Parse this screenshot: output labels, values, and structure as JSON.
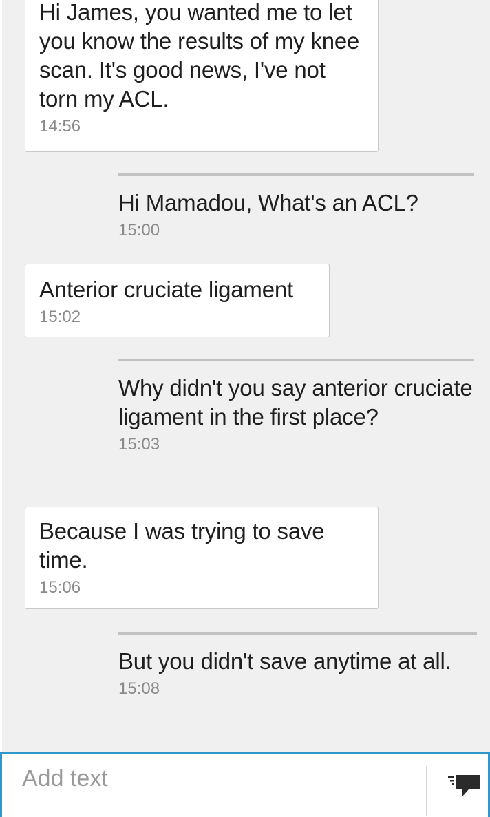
{
  "messages": [
    {
      "direction": "incoming",
      "text": "Hi James, you wanted me to let you know the results of my knee scan. It's good news, I've not torn my ACL.",
      "time": "14:56"
    },
    {
      "direction": "outgoing",
      "text": "Hi Mamadou, What's an ACL?",
      "time": "15:00"
    },
    {
      "direction": "incoming",
      "text": "Anterior cruciate ligament",
      "time": "15:02"
    },
    {
      "direction": "outgoing",
      "text": "Why didn't you say anterior cruciate ligament in the first place?",
      "time": "15:03"
    },
    {
      "direction": "incoming",
      "text": "Because I was trying to save time.",
      "time": "15:06"
    },
    {
      "direction": "outgoing",
      "text": "But you didn't save anytime at all.",
      "time": "15:08"
    }
  ],
  "composer": {
    "placeholder": "Add text",
    "value": "",
    "send_icon": "send-message-icon"
  },
  "colors": {
    "background": "#eff0ef",
    "incoming_bubble": "#ffffff",
    "outgoing_rule": "#c2c2c2",
    "composer_border": "#2f97c9",
    "timestamp": "#8a8a8a"
  }
}
